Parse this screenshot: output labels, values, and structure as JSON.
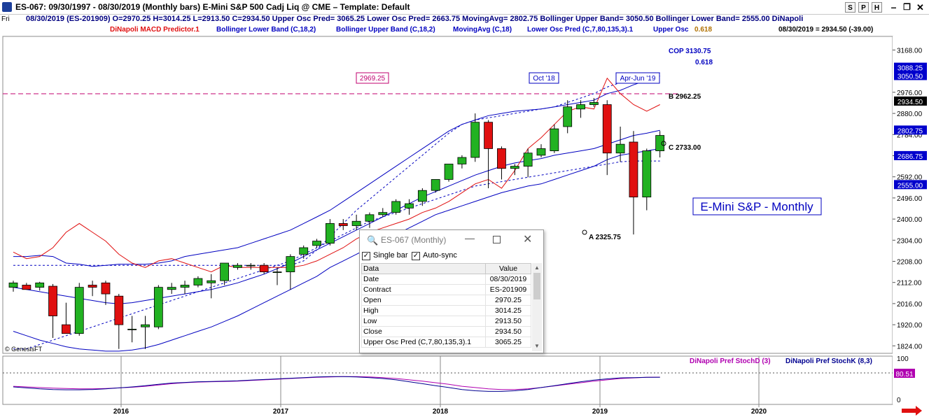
{
  "window": {
    "title": "ES-067:  09/30/1997 - 08/30/2019  (Monthly bars)   E-Mini S&P 500 Cadj Liq @ CME  –  Template: Default",
    "buttons": [
      "S",
      "P",
      "H"
    ]
  },
  "infobar": {
    "day": "Fri",
    "text": "08/30/2019 (ES-201909)   O=2970.25   H=3014.25   L=2913.50   C=2934.50   Upper Osc Pred= 3065.25   Lower Osc Pred= 2663.75   MovingAvg= 2802.75   Bollinger Upper Band= 3050.50   Bollinger Lower Band= 2555.00   DiNapoli"
  },
  "legend": {
    "macd": "DiNapoli MACD Predictor.1",
    "bb_lower": "Bollinger Lower Band (C,18,2)",
    "bb_upper": "Bollinger Upper Band (C,18,2)",
    "mavg": "MovingAvg (C,18)",
    "lower_osc": "Lower Osc Pred (C,7,80,135,3).1",
    "upper_osc": "Upper Osc",
    "fib_tag": "0.618",
    "summary": "08/30/2019 = 2934.50 (-39.00)"
  },
  "colors": {
    "bull": "#22b222",
    "bear": "#e01010",
    "macd_line": "#e01010",
    "band_line": "#0000c0",
    "stoch_d": "#b000b0",
    "stoch_k": "#000090",
    "dashed_level": "#c0006f",
    "price_label_bg": "#0000cc"
  },
  "annotations": {
    "box_2969": "2969.25",
    "oct18": "Oct '18",
    "aprjun19": "Apr-Jun '19",
    "cop": "COP 3130.75",
    "fib": "0.618",
    "b_label": "B 2962.25",
    "c_label": "C 2733.00",
    "a_label": "A 2325.75",
    "chart_title": "E-Mini S&P - Monthly",
    "copyright": "© GenesisFT"
  },
  "price_axis": {
    "ticks": [
      "3168.00",
      "2976.00",
      "2880.00",
      "2784.00",
      "2688.00",
      "2592.00",
      "2496.00",
      "2400.00",
      "2304.00",
      "2208.00",
      "2112.00",
      "2016.00",
      "1920.00",
      "1824.00"
    ],
    "labels": [
      {
        "text": "3088.25",
        "v": 3088.25
      },
      {
        "text": "3050.50",
        "v": 3050.5
      },
      {
        "text": "2934.50",
        "v": 2934.5,
        "dark": true
      },
      {
        "text": "2802.75",
        "v": 2802.75
      },
      {
        "text": "2686.75",
        "v": 2686.75
      },
      {
        "text": "2555.00",
        "v": 2555
      }
    ]
  },
  "lower_panel": {
    "stoch_d_label": "DiNapoli Pref StochD (3)",
    "stoch_k_label": "DiNapoli Pref StochK (8,3)",
    "value_label": "80.51",
    "ticks": [
      "100",
      "0"
    ]
  },
  "time_axis": {
    "labels": [
      "2016",
      "2017",
      "2018",
      "2019",
      "2020"
    ]
  },
  "popup": {
    "title": "ES-067 (Monthly)",
    "single_bar": "Single bar",
    "auto_sync": "Auto-sync",
    "header": [
      "Data",
      "Value"
    ],
    "rows": [
      [
        "Date",
        "08/30/2019"
      ],
      [
        "Contract",
        "ES-201909"
      ],
      [
        "Open",
        "2970.25"
      ],
      [
        "High",
        "3014.25"
      ],
      [
        "Low",
        "2913.50"
      ],
      [
        "Close",
        "2934.50"
      ],
      [
        "Upper Osc Pred (C,7,80,135,3).1",
        "3065.25"
      ]
    ]
  },
  "chart_data": {
    "type": "candlestick",
    "title": "E-Mini S&P - Monthly",
    "ylim": [
      1790,
      3230
    ],
    "x_range": [
      "2015-07",
      "2019-08"
    ],
    "candles": [
      {
        "date": "2015-07",
        "o": 2090,
        "h": 2120,
        "l": 2070,
        "c": 2110
      },
      {
        "date": "2015-08",
        "o": 2100,
        "h": 2110,
        "l": 2080,
        "c": 2080
      },
      {
        "date": "2015-09",
        "o": 2090,
        "h": 2115,
        "l": 2075,
        "c": 2110
      },
      {
        "date": "2015-10",
        "o": 2095,
        "h": 2105,
        "l": 1860,
        "c": 1960
      },
      {
        "date": "2015-11",
        "o": 1920,
        "h": 2020,
        "l": 1880,
        "c": 1880
      },
      {
        "date": "2015-12",
        "o": 1880,
        "h": 2110,
        "l": 1870,
        "c": 2090
      },
      {
        "date": "2016-01",
        "o": 2100,
        "h": 2120,
        "l": 2050,
        "c": 2090
      },
      {
        "date": "2016-02",
        "o": 2110,
        "h": 2120,
        "l": 2010,
        "c": 2060
      },
      {
        "date": "2016-03",
        "o": 2050,
        "h": 2060,
        "l": 1810,
        "c": 1920
      },
      {
        "date": "2016-04",
        "o": 1900,
        "h": 1960,
        "l": 1840,
        "c": 1900
      },
      {
        "date": "2016-05",
        "o": 1910,
        "h": 1960,
        "l": 1810,
        "c": 1920
      },
      {
        "date": "2016-06",
        "o": 1910,
        "h": 2100,
        "l": 1900,
        "c": 2090
      },
      {
        "date": "2016-07",
        "o": 2080,
        "h": 2110,
        "l": 2060,
        "c": 2090
      },
      {
        "date": "2016-08",
        "o": 2090,
        "h": 2120,
        "l": 2060,
        "c": 2100
      },
      {
        "date": "2016-09",
        "o": 2100,
        "h": 2140,
        "l": 2090,
        "c": 2130
      },
      {
        "date": "2016-10",
        "o": 2110,
        "h": 2150,
        "l": 2040,
        "c": 2120
      },
      {
        "date": "2016-11",
        "o": 2120,
        "h": 2200,
        "l": 2100,
        "c": 2200
      },
      {
        "date": "2016-12",
        "o": 2180,
        "h": 2200,
        "l": 2170,
        "c": 2190
      },
      {
        "date": "2017-01",
        "o": 2190,
        "h": 2200,
        "l": 2170,
        "c": 2190
      },
      {
        "date": "2017-02",
        "o": 2190,
        "h": 2200,
        "l": 2150,
        "c": 2160
      },
      {
        "date": "2017-03",
        "o": 2160,
        "h": 2180,
        "l": 2100,
        "c": 2160
      },
      {
        "date": "2017-04",
        "o": 2160,
        "h": 2240,
        "l": 2080,
        "c": 2230
      },
      {
        "date": "2017-05",
        "o": 2240,
        "h": 2280,
        "l": 2220,
        "c": 2270
      },
      {
        "date": "2017-06",
        "o": 2280,
        "h": 2310,
        "l": 2270,
        "c": 2300
      },
      {
        "date": "2017-07",
        "o": 2290,
        "h": 2400,
        "l": 2280,
        "c": 2380
      },
      {
        "date": "2017-08",
        "o": 2380,
        "h": 2400,
        "l": 2350,
        "c": 2370
      },
      {
        "date": "2017-09",
        "o": 2370,
        "h": 2420,
        "l": 2350,
        "c": 2390
      },
      {
        "date": "2017-10",
        "o": 2390,
        "h": 2430,
        "l": 2360,
        "c": 2420
      },
      {
        "date": "2017-11",
        "o": 2420,
        "h": 2450,
        "l": 2410,
        "c": 2430
      },
      {
        "date": "2017-12",
        "o": 2430,
        "h": 2490,
        "l": 2420,
        "c": 2480
      },
      {
        "date": "2018-01",
        "o": 2450,
        "h": 2490,
        "l": 2420,
        "c": 2470
      },
      {
        "date": "2018-02",
        "o": 2480,
        "h": 2540,
        "l": 2460,
        "c": 2530
      },
      {
        "date": "2018-03",
        "o": 2530,
        "h": 2580,
        "l": 2520,
        "c": 2580
      },
      {
        "date": "2018-04",
        "o": 2580,
        "h": 2650,
        "l": 2570,
        "c": 2650
      },
      {
        "date": "2018-05",
        "o": 2650,
        "h": 2690,
        "l": 2630,
        "c": 2680
      },
      {
        "date": "2018-06",
        "o": 2680,
        "h": 2880,
        "l": 2660,
        "c": 2840
      },
      {
        "date": "2018-07",
        "o": 2840,
        "h": 2850,
        "l": 2540,
        "c": 2720
      },
      {
        "date": "2018-08",
        "o": 2720,
        "h": 2730,
        "l": 2580,
        "c": 2630
      },
      {
        "date": "2018-09",
        "o": 2630,
        "h": 2650,
        "l": 2600,
        "c": 2640
      },
      {
        "date": "2018-10",
        "o": 2640,
        "h": 2720,
        "l": 2590,
        "c": 2700
      },
      {
        "date": "2018-11",
        "o": 2690,
        "h": 2740,
        "l": 2680,
        "c": 2720
      },
      {
        "date": "2018-12",
        "o": 2710,
        "h": 2830,
        "l": 2700,
        "c": 2810
      },
      {
        "date": "2019-01",
        "o": 2820,
        "h": 2940,
        "l": 2790,
        "c": 2910
      },
      {
        "date": "2019-02",
        "o": 2900,
        "h": 2940,
        "l": 2860,
        "c": 2920
      },
      {
        "date": "2019-03",
        "o": 2920,
        "h": 2950,
        "l": 2910,
        "c": 2930
      },
      {
        "date": "2019-04",
        "o": 2920,
        "h": 2940,
        "l": 2600,
        "c": 2700
      },
      {
        "date": "2019-05",
        "o": 2700,
        "h": 2820,
        "l": 2660,
        "c": 2740
      },
      {
        "date": "2019-06",
        "o": 2750,
        "h": 2800,
        "l": 2330,
        "c": 2500
      },
      {
        "date": "2019-07",
        "o": 2500,
        "h": 2720,
        "l": 2440,
        "c": 2710
      },
      {
        "date": "2019-08",
        "o": 2710,
        "h": 2800,
        "l": 2680,
        "c": 2780
      }
    ],
    "macd_predictor": [
      2250,
      2220,
      2230,
      2270,
      2340,
      2380,
      2340,
      2300,
      2240,
      2200,
      2180,
      2210,
      2220,
      2200,
      2180,
      2160,
      2190,
      2180,
      2180,
      2180,
      2180,
      2180,
      2190,
      2210,
      2240,
      2270,
      2310,
      2340,
      2360,
      2380,
      2400,
      2430,
      2450,
      2480,
      2520,
      2560,
      2580,
      2540,
      2620,
      2720,
      2770,
      2830,
      2890,
      2910,
      2900,
      3040,
      2970,
      2920,
      2890,
      2920
    ],
    "bollinger_upper": [
      2230,
      2230,
      2235,
      2230,
      2200,
      2195,
      2185,
      2190,
      2195,
      2195,
      2195,
      2200,
      2210,
      2230,
      2240,
      2250,
      2260,
      2270,
      2290,
      2310,
      2330,
      2350,
      2380,
      2410,
      2440,
      2480,
      2520,
      2560,
      2600,
      2640,
      2680,
      2720,
      2760,
      2800,
      2830,
      2850,
      2870,
      2880,
      2890,
      2895,
      2900,
      2910,
      2920,
      2930,
      2940,
      2970,
      2985,
      3010,
      3030,
      3050
    ],
    "moving_avg": [
      2090,
      2080,
      2070,
      2060,
      2050,
      2040,
      2030,
      2020,
      2015,
      2020,
      2030,
      2040,
      2050,
      2060,
      2070,
      2080,
      2095,
      2110,
      2130,
      2150,
      2175,
      2200,
      2230,
      2260,
      2290,
      2320,
      2350,
      2380,
      2410,
      2440,
      2470,
      2500,
      2525,
      2550,
      2575,
      2600,
      2620,
      2640,
      2655,
      2665,
      2675,
      2690,
      2700,
      2710,
      2720,
      2740,
      2760,
      2780,
      2790,
      2803
    ],
    "bollinger_lower": [
      1890,
      1870,
      1850,
      1835,
      1820,
      1810,
      1805,
      1800,
      1800,
      1805,
      1815,
      1830,
      1850,
      1870,
      1890,
      1910,
      1935,
      1960,
      1990,
      2020,
      2050,
      2080,
      2110,
      2140,
      2180,
      2210,
      2240,
      2270,
      2300,
      2330,
      2360,
      2390,
      2420,
      2440,
      2460,
      2480,
      2500,
      2520,
      2535,
      2550,
      2560,
      2580,
      2600,
      2620,
      2640,
      2670,
      2690,
      2700,
      2710,
      2720
    ],
    "osc_pred_upper": [
      2190,
      2190,
      2190,
      2190,
      2190,
      2190,
      2190,
      2190,
      2190,
      2190,
      2190,
      2190,
      2190,
      2190,
      2190,
      2190,
      2190,
      2190,
      2190,
      2190,
      2190,
      2190,
      2210,
      2260,
      2320,
      2380,
      2440,
      2490,
      2540,
      2590,
      2640,
      2690,
      2740,
      2790,
      2830,
      2850,
      2860,
      2870,
      2880,
      2890,
      2900,
      2910,
      2930,
      2950,
      2970,
      3000,
      3020,
      3040,
      3050,
      3065
    ],
    "osc_pred_lower": [
      1810,
      1810,
      1830,
      1850,
      1870,
      1890,
      1910,
      1930,
      1950,
      1970,
      1990,
      2010,
      2030,
      2050,
      2070,
      2090,
      2110,
      2130,
      2150,
      2170,
      2190,
      2210,
      2240,
      2270,
      2300,
      2330,
      2360,
      2390,
      2410,
      2430,
      2450,
      2470,
      2490,
      2510,
      2530,
      2550,
      2560,
      2570,
      2580,
      2590,
      2600,
      2610,
      2620,
      2630,
      2640,
      2650,
      2660,
      2664,
      2664,
      2664
    ],
    "stoch_d": [
      52,
      50,
      48,
      46,
      45,
      44,
      44,
      45,
      47,
      49,
      52,
      56,
      60,
      63,
      65,
      66,
      67,
      68,
      70,
      72,
      74,
      76,
      78,
      80,
      81,
      82,
      82,
      81,
      79,
      76,
      72,
      68,
      63,
      58,
      52,
      48,
      44,
      42,
      42,
      44,
      48,
      53,
      58,
      63,
      68,
      72,
      76,
      78,
      80,
      80.51
    ],
    "stoch_k": [
      50,
      47,
      44,
      42,
      41,
      41,
      42,
      44,
      47,
      50,
      54,
      58,
      62,
      64,
      66,
      67,
      68,
      69,
      71,
      73,
      75,
      77,
      79,
      81,
      82,
      82,
      81,
      79,
      76,
      72,
      66,
      60,
      54,
      48,
      42,
      38,
      36,
      36,
      38,
      42,
      48,
      54,
      60,
      66,
      71,
      75,
      78,
      79,
      80,
      80
    ],
    "dashed_level": 2969.25
  }
}
